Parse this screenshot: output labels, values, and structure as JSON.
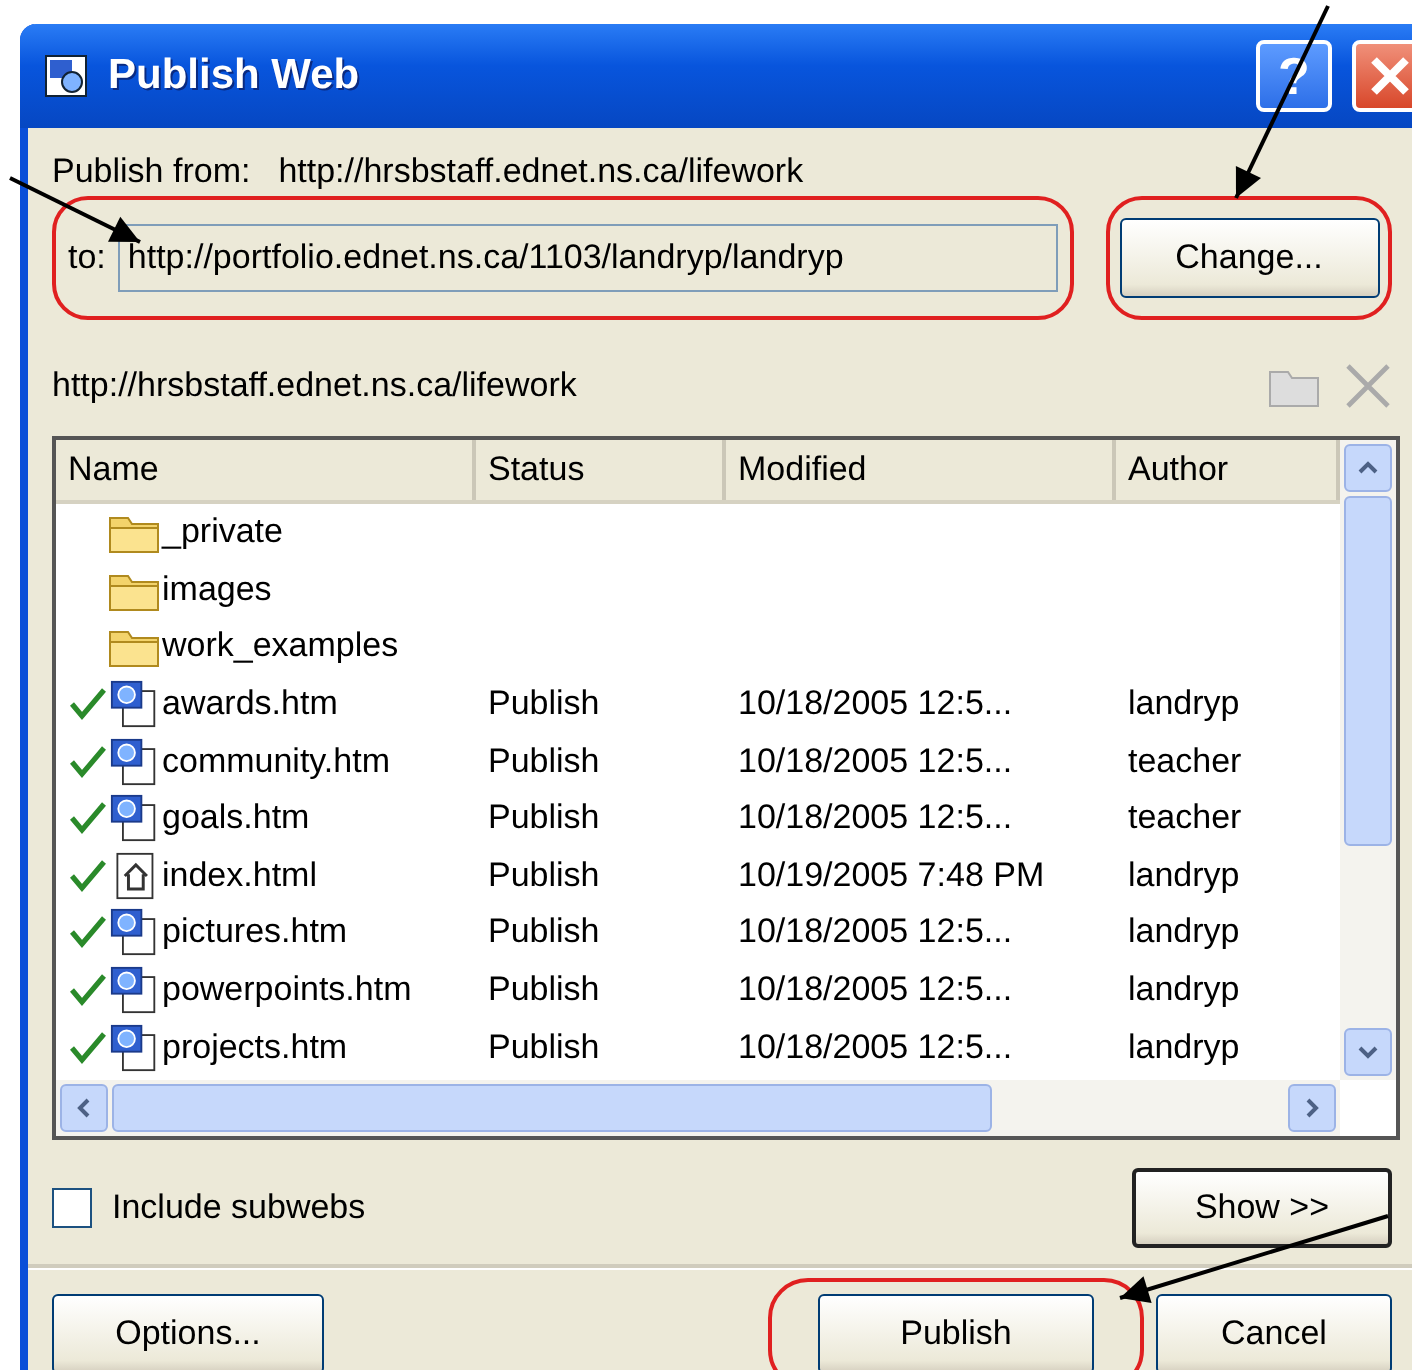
{
  "window": {
    "title": "Publish Web",
    "help_button": "?"
  },
  "publish_from": {
    "label": "Publish from:",
    "value": "http://hrsbstaff.ednet.ns.ca/lifework"
  },
  "to_field": {
    "label": "to:",
    "value": "http://portfolio.ednet.ns.ca/1103/landryp/landryp",
    "highlighted": true
  },
  "change_button": {
    "label": "Change...",
    "highlighted": true
  },
  "source_path": "http://hrsbstaff.ednet.ns.ca/lifework",
  "file_list": {
    "columns": [
      "Name",
      "Status",
      "Modified",
      "Author"
    ],
    "rows": [
      {
        "kind": "folder",
        "name": "_private",
        "published": false
      },
      {
        "kind": "folder",
        "name": "images",
        "published": false
      },
      {
        "kind": "folder",
        "name": "work_examples",
        "published": false
      },
      {
        "kind": "page",
        "name": "awards.htm",
        "status": "Publish",
        "modified": "10/18/2005 12:5...",
        "author": "landryp",
        "published": true
      },
      {
        "kind": "page",
        "name": "community.htm",
        "status": "Publish",
        "modified": "10/18/2005 12:5...",
        "author": "teacher",
        "published": true
      },
      {
        "kind": "page",
        "name": "goals.htm",
        "status": "Publish",
        "modified": "10/18/2005 12:5...",
        "author": "teacher",
        "published": true
      },
      {
        "kind": "home",
        "name": "index.html",
        "status": "Publish",
        "modified": "10/19/2005 7:48 PM",
        "author": "landryp",
        "published": true
      },
      {
        "kind": "page",
        "name": "pictures.htm",
        "status": "Publish",
        "modified": "10/18/2005 12:5...",
        "author": "landryp",
        "published": true
      },
      {
        "kind": "page",
        "name": "powerpoints.htm",
        "status": "Publish",
        "modified": "10/18/2005 12:5...",
        "author": "landryp",
        "published": true
      },
      {
        "kind": "page",
        "name": "projects.htm",
        "status": "Publish",
        "modified": "10/18/2005 12:5...",
        "author": "landryp",
        "published": true
      }
    ]
  },
  "include_subwebs": {
    "label": "Include subwebs",
    "checked": false
  },
  "show_button": {
    "label": "Show >>"
  },
  "buttons": [
    {
      "label": "Options..."
    },
    {
      "label": "Publish",
      "highlighted": true
    },
    {
      "label": "Cancel"
    }
  ]
}
